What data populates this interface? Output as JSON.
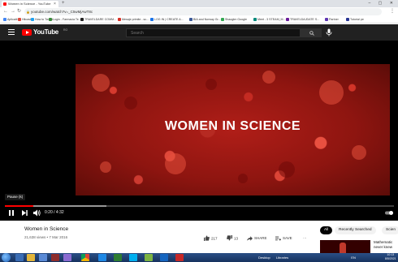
{
  "browser": {
    "tab_title": "Women in Science - YouTube",
    "tab_close": "×",
    "new_tab": "+",
    "window_controls": "–  ▢  ✕",
    "url": "youtube.com/watch?v=_C5wMjAwT8c",
    "bookmarks": [
      {
        "label": "Aplicatii",
        "color": "#4285f4"
      },
      {
        "label": "Hitcast",
        "color": "#e04a3c"
      },
      {
        "label": "How to Tweet",
        "color": "#1da1f2"
      },
      {
        "label": "Login - Farmacia Te...",
        "color": "#3a8a3a"
      },
      {
        "label": "TRAVELDARE COMM...",
        "color": "#222222"
      },
      {
        "label": "Mesaje primite - sc...",
        "color": "#d93025"
      },
      {
        "label": "LOG IN | CREATE A...",
        "color": "#1a73e8"
      },
      {
        "label": "BIA and Norway Gr...",
        "color": "#3b5998"
      },
      {
        "label": "Shaogtm Google",
        "color": "#34a853"
      },
      {
        "label": "Meet - 3 STEAM_M...",
        "color": "#00897b"
      },
      {
        "label": "TRAVELDAJDATE S...",
        "color": "#6a1b9a"
      },
      {
        "label": "Partner",
        "color": "#5e35b1"
      },
      {
        "label": "Tutorial pe",
        "color": "#283593"
      }
    ]
  },
  "youtube": {
    "logo_text": "YouTube",
    "logo_country": "RO",
    "search_placeholder": "Search"
  },
  "player": {
    "overlay_title": "WOMEN IN SCIENCE",
    "tooltip": "Pause (k)",
    "time": "0:20 / 4:32",
    "played_fraction": 0.0735,
    "buffered_fraction": 0.26
  },
  "video": {
    "title": "Women in Science",
    "meta": "21,638 views • 7 Mar 2016",
    "likes": "217",
    "dislikes": "13",
    "share": "SHARE",
    "save": "SAVE",
    "more": "···"
  },
  "chips": [
    "All",
    "Recently Searched",
    "Scien"
  ],
  "recommendation": {
    "title_line1": "Mathematic",
    "title_line2": "never knew"
  },
  "taskbar": {
    "desktop_label": "Desktop",
    "libraries_label": "Libraries",
    "lang": "EN",
    "time": "10:13",
    "date": "8/5/2021"
  }
}
